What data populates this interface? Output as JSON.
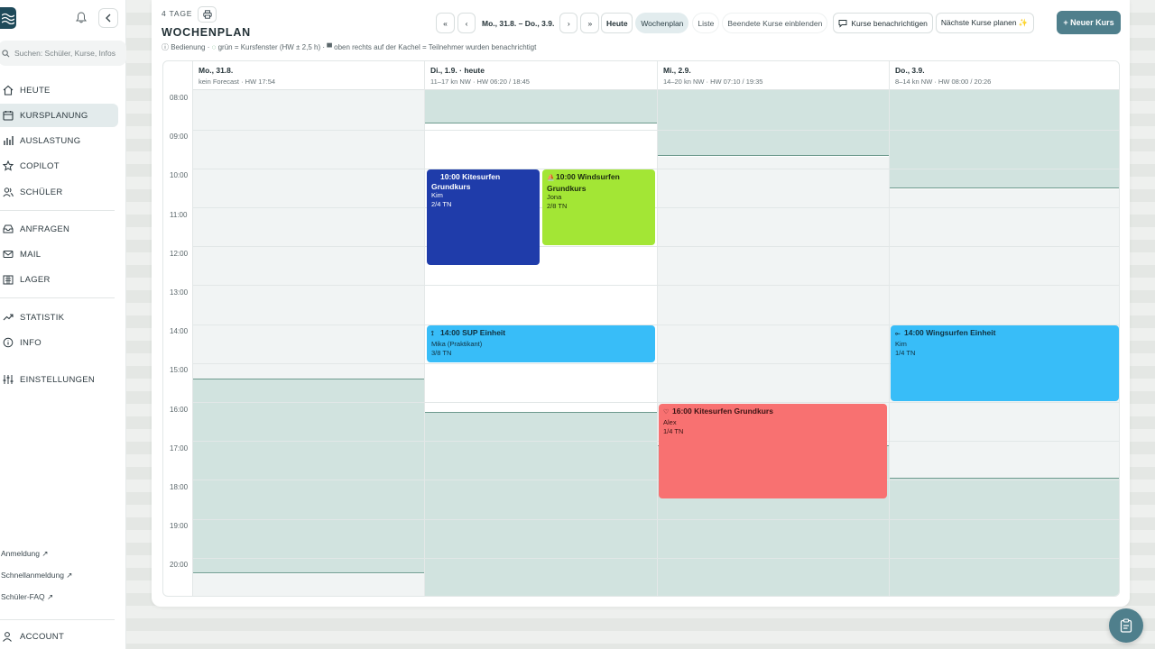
{
  "sidebar": {
    "search_placeholder": "Suchen: Schüler, Kurse, Infos",
    "nav": [
      {
        "label": "HEUTE",
        "icon": "home-icon"
      },
      {
        "label": "KURSPLANUNG",
        "icon": "calendar-icon",
        "active": true
      },
      {
        "label": "AUSLASTUNG",
        "icon": "bar-chart-icon"
      },
      {
        "label": "COPILOT",
        "icon": "star-icon"
      },
      {
        "label": "SCHÜLER",
        "icon": "users-icon"
      },
      {
        "label": "ANFRAGEN",
        "icon": "inbox-icon"
      },
      {
        "label": "MAIL",
        "icon": "mail-icon"
      },
      {
        "label": "LAGER",
        "icon": "warehouse-icon"
      },
      {
        "label": "STATISTIK",
        "icon": "trend-icon"
      },
      {
        "label": "INFO",
        "icon": "info-icon"
      },
      {
        "label": "EINSTELLUNGEN",
        "icon": "sliders-icon"
      }
    ],
    "links": [
      "Anmeldung ↗",
      "Schnellanmeldung ↗",
      "Schüler-FAQ ↗"
    ],
    "account": "ACCOUNT"
  },
  "header": {
    "days_label": "4 TAGE",
    "title": "WOCHENPLAN",
    "legend": {
      "prefix": "ⓘ Bedienung · ",
      "green": "◌",
      "text": " grün = Kursfenster (HW ± 2,5 h) · ▀ oben rechts auf der Kachel = Teilnehmer wurden benachrichtigt"
    }
  },
  "toolbar": {
    "first": "«",
    "prev": "‹",
    "range": "Mo., 31.8. – Do., 3.9.",
    "next": "›",
    "last": "»",
    "today": "Heute",
    "week": "Wochenplan",
    "list": "Liste",
    "show_finished": "Beendete Kurse einblenden",
    "notify": "Kurse benachrichtigen",
    "plan_next": "Nächste Kurse planen ✨",
    "new_course": "+ Neuer Kurs"
  },
  "calendar": {
    "times": [
      "08:00",
      "09:00",
      "10:00",
      "11:00",
      "12:00",
      "13:00",
      "14:00",
      "15:00",
      "16:00",
      "17:00",
      "18:00",
      "19:00",
      "20:00"
    ],
    "days": [
      {
        "title": "Mo., 31.8.",
        "sub": "kein Forecast · HW 17:54"
      },
      {
        "title": "Di., 1.9. · heute",
        "sub": "11–17 kn NW · HW 06:20 / 18:45"
      },
      {
        "title": "Mi., 2.9.",
        "sub": "14–20 kn NW · HW 07:10 / 19:35"
      },
      {
        "title": "Do., 3.9.",
        "sub": "8–14 kn NW · HW 08:00 / 20:26"
      }
    ],
    "events": [
      {
        "title": "10:00 Kitesurfen Grundkurs",
        "teacher": "Kim",
        "participants": "2/4 TN",
        "color": "#1f3caa"
      },
      {
        "title": "10:00 Windsurfen Grundkurs",
        "teacher": "Jona",
        "participants": "2/8 TN",
        "color": "#a3e635"
      },
      {
        "title": "14:00 SUP Einheit",
        "teacher": "Mika (Praktikant)",
        "participants": "3/8 TN",
        "color": "#38bdf8"
      },
      {
        "title": "14:00 Wingsurfen Einheit",
        "teacher": "Kim",
        "participants": "1/4 TN",
        "color": "#38bdf8"
      },
      {
        "title": "16:00 Kitesurfen Grundkurs",
        "teacher": "Alex",
        "participants": "1/4 TN",
        "color": "#f87171"
      }
    ]
  },
  "colors": {
    "accent": "#4f7f8c",
    "window_green": "#d1e3df"
  }
}
